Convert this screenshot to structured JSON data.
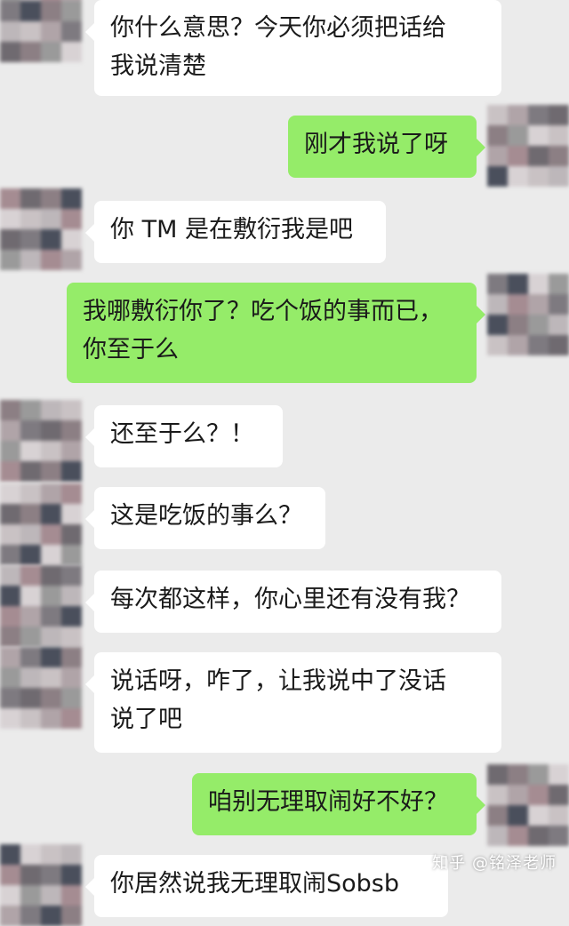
{
  "messages": [
    {
      "side": "in",
      "text": "你什么意思？今天你必须把话给\n我说清楚"
    },
    {
      "side": "out",
      "text": "刚才我说了呀"
    },
    {
      "side": "in",
      "text": "你 TM 是在敷衍我是吧"
    },
    {
      "side": "out",
      "text": "我哪敷衍你了？吃个饭的事而已，\n你至于么"
    },
    {
      "side": "in",
      "text": "还至于么？！"
    },
    {
      "side": "in",
      "text": "这是吃饭的事么？"
    },
    {
      "side": "in",
      "text": "每次都这样，你心里还有没有我？"
    },
    {
      "side": "in",
      "text": "说话呀，咋了，让我说中了没话\n说了吧"
    },
    {
      "side": "out",
      "text": "咱别无理取闹好不好？"
    },
    {
      "side": "in",
      "text": "你居然说我无理取闹Sobsb"
    }
  ],
  "watermark": "知乎 @铭泽老师",
  "colors": {
    "background": "#ebebeb",
    "incoming_bubble": "#ffffff",
    "outgoing_bubble": "#95ec69"
  }
}
